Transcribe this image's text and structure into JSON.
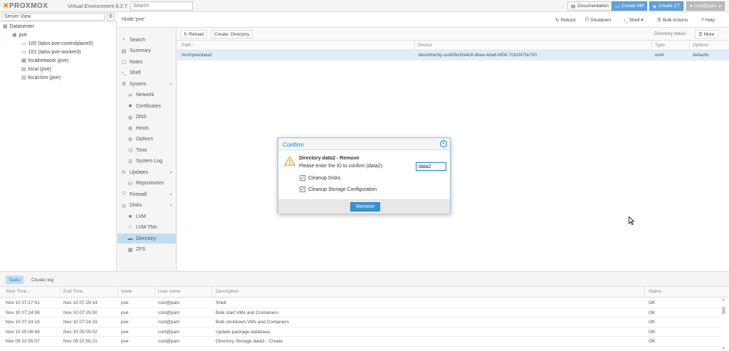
{
  "topbar": {
    "logo": "PROXMOX",
    "version": "Virtual Environment 8.2.7",
    "search_placeholder": "Search",
    "documentation": "Documentation",
    "create_vm": "Create VM",
    "create_ct": "Create CT",
    "user": "root@pam"
  },
  "serverview": {
    "label": "Server View",
    "tree": [
      {
        "label": "Datacenter",
        "indent": 0,
        "icon": "datacenter-icon"
      },
      {
        "label": "pve",
        "indent": 1,
        "icon": "server-icon"
      },
      {
        "label": "100 (talos-pve-controlplane0)",
        "indent": 2,
        "icon": "vm-icon"
      },
      {
        "label": "101 (talos-pve-worker0)",
        "indent": 2,
        "icon": "vm-icon"
      },
      {
        "label": "localnetwork (pve)",
        "indent": 2,
        "icon": "network-icon"
      },
      {
        "label": "local (pve)",
        "indent": 2,
        "icon": "storage-icon"
      },
      {
        "label": "local-lvm (pve)",
        "indent": 2,
        "icon": "storage-icon"
      }
    ]
  },
  "node": {
    "title": "Node 'pve'",
    "reboot": "Reboot",
    "shutdown": "Shutdown",
    "shell": "Shell",
    "bulk_actions": "Bulk Actions",
    "help": "Help"
  },
  "menu": [
    {
      "label": "Search",
      "icon": "search-icon",
      "sub": false
    },
    {
      "label": "Summary",
      "icon": "summary-icon",
      "sub": false
    },
    {
      "label": "Notes",
      "icon": "notes-icon",
      "sub": false
    },
    {
      "label": "Shell",
      "icon": "terminal-icon",
      "sub": false
    },
    {
      "label": "System",
      "icon": "gears-icon",
      "sub": false,
      "expand": true
    },
    {
      "label": "Network",
      "icon": "network-icon",
      "sub": true
    },
    {
      "label": "Certificates",
      "icon": "certificate-icon",
      "sub": true
    },
    {
      "label": "DNS",
      "icon": "globe-icon",
      "sub": true
    },
    {
      "label": "Hosts",
      "icon": "globe-icon",
      "sub": true
    },
    {
      "label": "Options",
      "icon": "gear-icon",
      "sub": true
    },
    {
      "label": "Time",
      "icon": "clock-icon",
      "sub": true
    },
    {
      "label": "System Log",
      "icon": "list-icon",
      "sub": true
    },
    {
      "label": "Updates",
      "icon": "refresh-icon",
      "sub": false,
      "expand": true
    },
    {
      "label": "Repositories",
      "icon": "repo-icon",
      "sub": true
    },
    {
      "label": "Firewall",
      "icon": "shield-icon",
      "sub": false,
      "expand": true
    },
    {
      "label": "Disks",
      "icon": "disk-icon",
      "sub": false,
      "expand": true
    },
    {
      "label": "LVM",
      "icon": "square-icon",
      "sub": true
    },
    {
      "label": "LVM-Thin",
      "icon": "square-outline-icon",
      "sub": true
    },
    {
      "label": "Directory",
      "icon": "folder-icon",
      "sub": true,
      "selected": true
    },
    {
      "label": "ZFS",
      "icon": "grid-icon",
      "sub": true
    }
  ],
  "content": {
    "reload": "Reload",
    "create_directory": "Create: Directory",
    "status_label": "Directory data2",
    "more": "More",
    "columns": [
      "Path ↑",
      "Device",
      "Type",
      "Options"
    ],
    "rows": [
      {
        "path": "/mnt/pve/data2",
        "device": "/dev/disk/by-uuid/9e3fa4c8-dbee-4da6-bf06-7cb1f47fe700",
        "type": "ext4",
        "options": "defaults"
      }
    ]
  },
  "dialog": {
    "title": "Confirm",
    "heading": "Directory data2 - Remove",
    "prompt": "Please enter the ID to confirm (data2):",
    "input_value": "data2",
    "check1": "Cleanup Disks",
    "check2": "Cleanup Storage Configuration",
    "remove": "Remove"
  },
  "tasks": {
    "tab_tasks": "Tasks",
    "tab_cluster": "Cluster log",
    "columns": [
      "Start Time ↓",
      "End Time",
      "Node",
      "User name",
      "Description",
      "Status"
    ],
    "rows": [
      {
        "start": "Nov 10 07:27:41",
        "end": "Nov 10 07:29:14",
        "node": "pve",
        "user": "root@pam",
        "desc": "Shell",
        "status": "OK"
      },
      {
        "start": "Nov 10 07:24:59",
        "end": "Nov 10 07:25:00",
        "node": "pve",
        "user": "root@pam",
        "desc": "Bulk start VMs and Containers",
        "status": "OK"
      },
      {
        "start": "Nov 10 07:24:19",
        "end": "Nov 10 07:24:19",
        "node": "pve",
        "user": "root@pam",
        "desc": "Bulk shutdown VMs and Containers",
        "status": "OK"
      },
      {
        "start": "Nov 10 05:08:49",
        "end": "Nov 10 05:09:02",
        "node": "pve",
        "user": "root@pam",
        "desc": "Update package database",
        "status": "OK"
      },
      {
        "start": "Nov 09 22:55:07",
        "end": "Nov 09 22:55:21",
        "node": "pve",
        "user": "root@pam",
        "desc": "Directory Storage data3 - Create",
        "status": "OK"
      }
    ]
  },
  "colors": {
    "accent": "#157fcc",
    "selected": "#c2ddf2",
    "brand_orange": "#e57000",
    "button_blue": "#5fa2dd"
  }
}
